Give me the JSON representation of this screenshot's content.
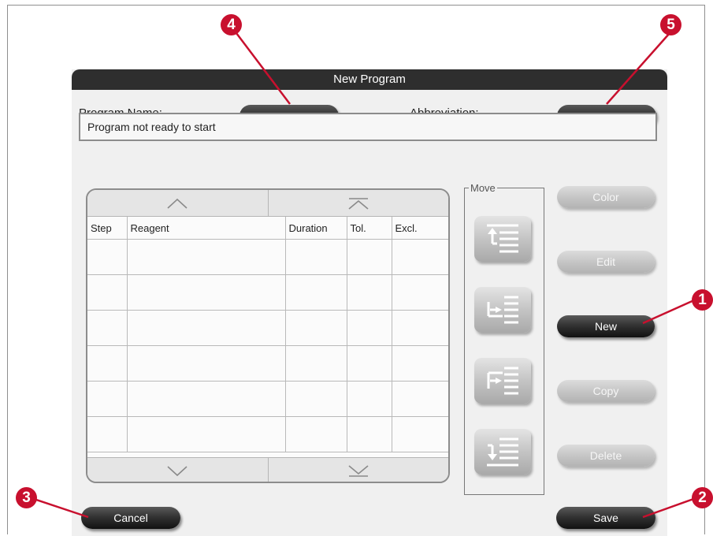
{
  "dialog": {
    "title": "New Program",
    "program_name_label": "Program Name:",
    "program_name_value": "--",
    "abbreviation_label": "Abbreviation:",
    "abbreviation_value": "--",
    "status_message": "Program not ready to start"
  },
  "table": {
    "columns": [
      "Step",
      "Reagent",
      "Duration",
      "Tol.",
      "Excl."
    ],
    "scroll_up_icon": "chevron-up-icon",
    "scroll_top_icon": "jump-to-top-icon",
    "scroll_down_icon": "chevron-down-icon",
    "scroll_bottom_icon": "jump-to-bottom-icon"
  },
  "move": {
    "label": "Move",
    "buttons": [
      "move-to-top-icon",
      "move-up-icon",
      "move-down-icon",
      "move-to-bottom-icon"
    ]
  },
  "actions": {
    "color": "Color",
    "edit": "Edit",
    "new": "New",
    "copy": "Copy",
    "delete": "Delete"
  },
  "footer": {
    "cancel": "Cancel",
    "save": "Save"
  },
  "callouts": [
    "1",
    "2",
    "3",
    "4",
    "5"
  ],
  "colors": {
    "titlebar": "#2e2e2e",
    "dark_button": "#333333",
    "disabled_button": "#c4c4c4",
    "callout": "#c8102e",
    "dialog_background": "#f0f0f0"
  }
}
